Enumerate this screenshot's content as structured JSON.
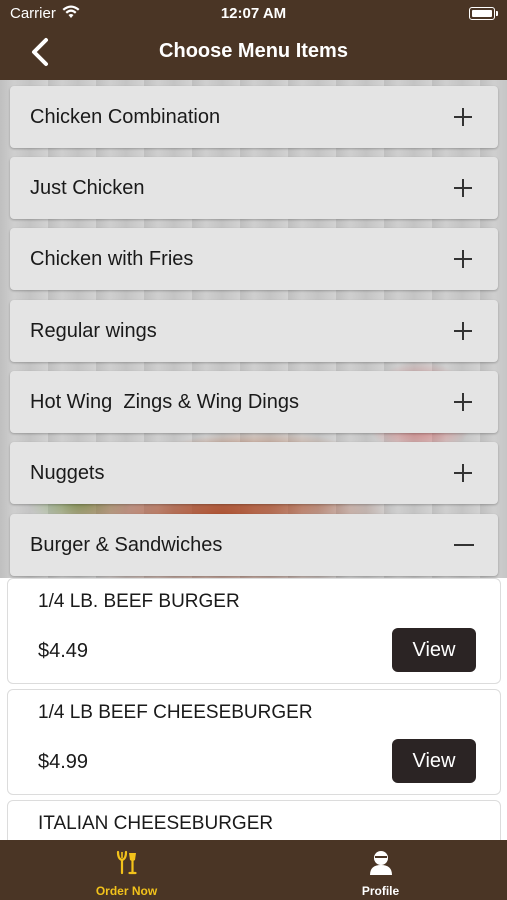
{
  "status_bar": {
    "carrier": "Carrier",
    "time": "12:07 AM"
  },
  "header": {
    "title": "Choose Menu Items",
    "back_icon": "chevron-left-icon"
  },
  "categories": [
    {
      "label": "Chicken Combination",
      "state": "collapsed"
    },
    {
      "label": "Just Chicken",
      "state": "collapsed"
    },
    {
      "label": "Chicken with Fries",
      "state": "collapsed"
    },
    {
      "label": "Regular wings",
      "state": "collapsed"
    },
    {
      "label": "Hot Wing  Zings & Wing Dings",
      "state": "collapsed"
    },
    {
      "label": "Nuggets",
      "state": "collapsed"
    },
    {
      "label": "Burger & Sandwiches",
      "state": "expanded"
    }
  ],
  "menu_items": [
    {
      "name": "1/4 LB. BEEF BURGER",
      "price": "$4.49",
      "button": "View"
    },
    {
      "name": "1/4 LB BEEF CHEESEBURGER",
      "price": "$4.99",
      "button": "View"
    },
    {
      "name": "ITALIAN CHEESEBURGER",
      "price": "",
      "button": ""
    }
  ],
  "tab_bar": {
    "tabs": [
      {
        "label": "Order Now",
        "icon": "utensils-icon",
        "active": true
      },
      {
        "label": "Profile",
        "icon": "person-icon",
        "active": false
      }
    ]
  },
  "colors": {
    "brand_brown": "#4a3525",
    "active_tab": "#f2c21b",
    "button_dark": "#2b2424",
    "category_bg": "#e4e4e4"
  }
}
